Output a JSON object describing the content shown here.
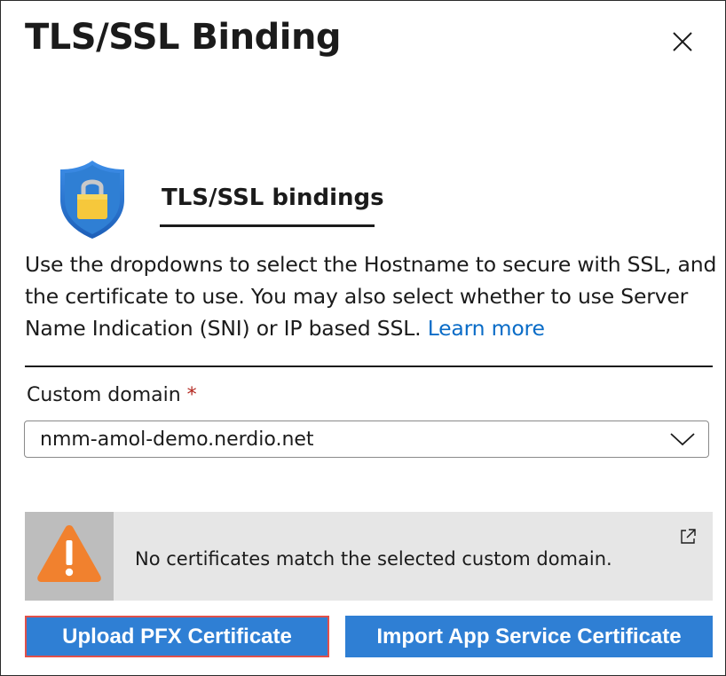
{
  "panel": {
    "title": "TLS/SSL Binding",
    "close_icon": "close-icon"
  },
  "section": {
    "icon": "shield-lock-icon",
    "tab_label": "TLS/SSL bindings"
  },
  "description": {
    "text": "Use the dropdowns to select the Hostname to secure with SSL, and the certificate to use. You may also select whether to use Server Name Indication (SNI) or IP based SSL.",
    "link_text": "Learn more"
  },
  "custom_domain": {
    "label": "Custom domain",
    "required_marker": "*",
    "selected_value": "nmm-amol-demo.nerdio.net",
    "chevron_icon": "chevron-down-icon"
  },
  "warning": {
    "icon": "warning-icon",
    "message": "No certificates match the selected custom domain.",
    "link_icon": "external-link-icon"
  },
  "actions": {
    "upload_label": "Upload PFX Certificate",
    "import_label": "Import App Service Certificate"
  },
  "colors": {
    "primary_button": "#2f7fd4",
    "link": "#0a6cc7",
    "warning_orange": "#f1812e",
    "required": "#b3261e",
    "highlight_border": "#e0504a"
  }
}
